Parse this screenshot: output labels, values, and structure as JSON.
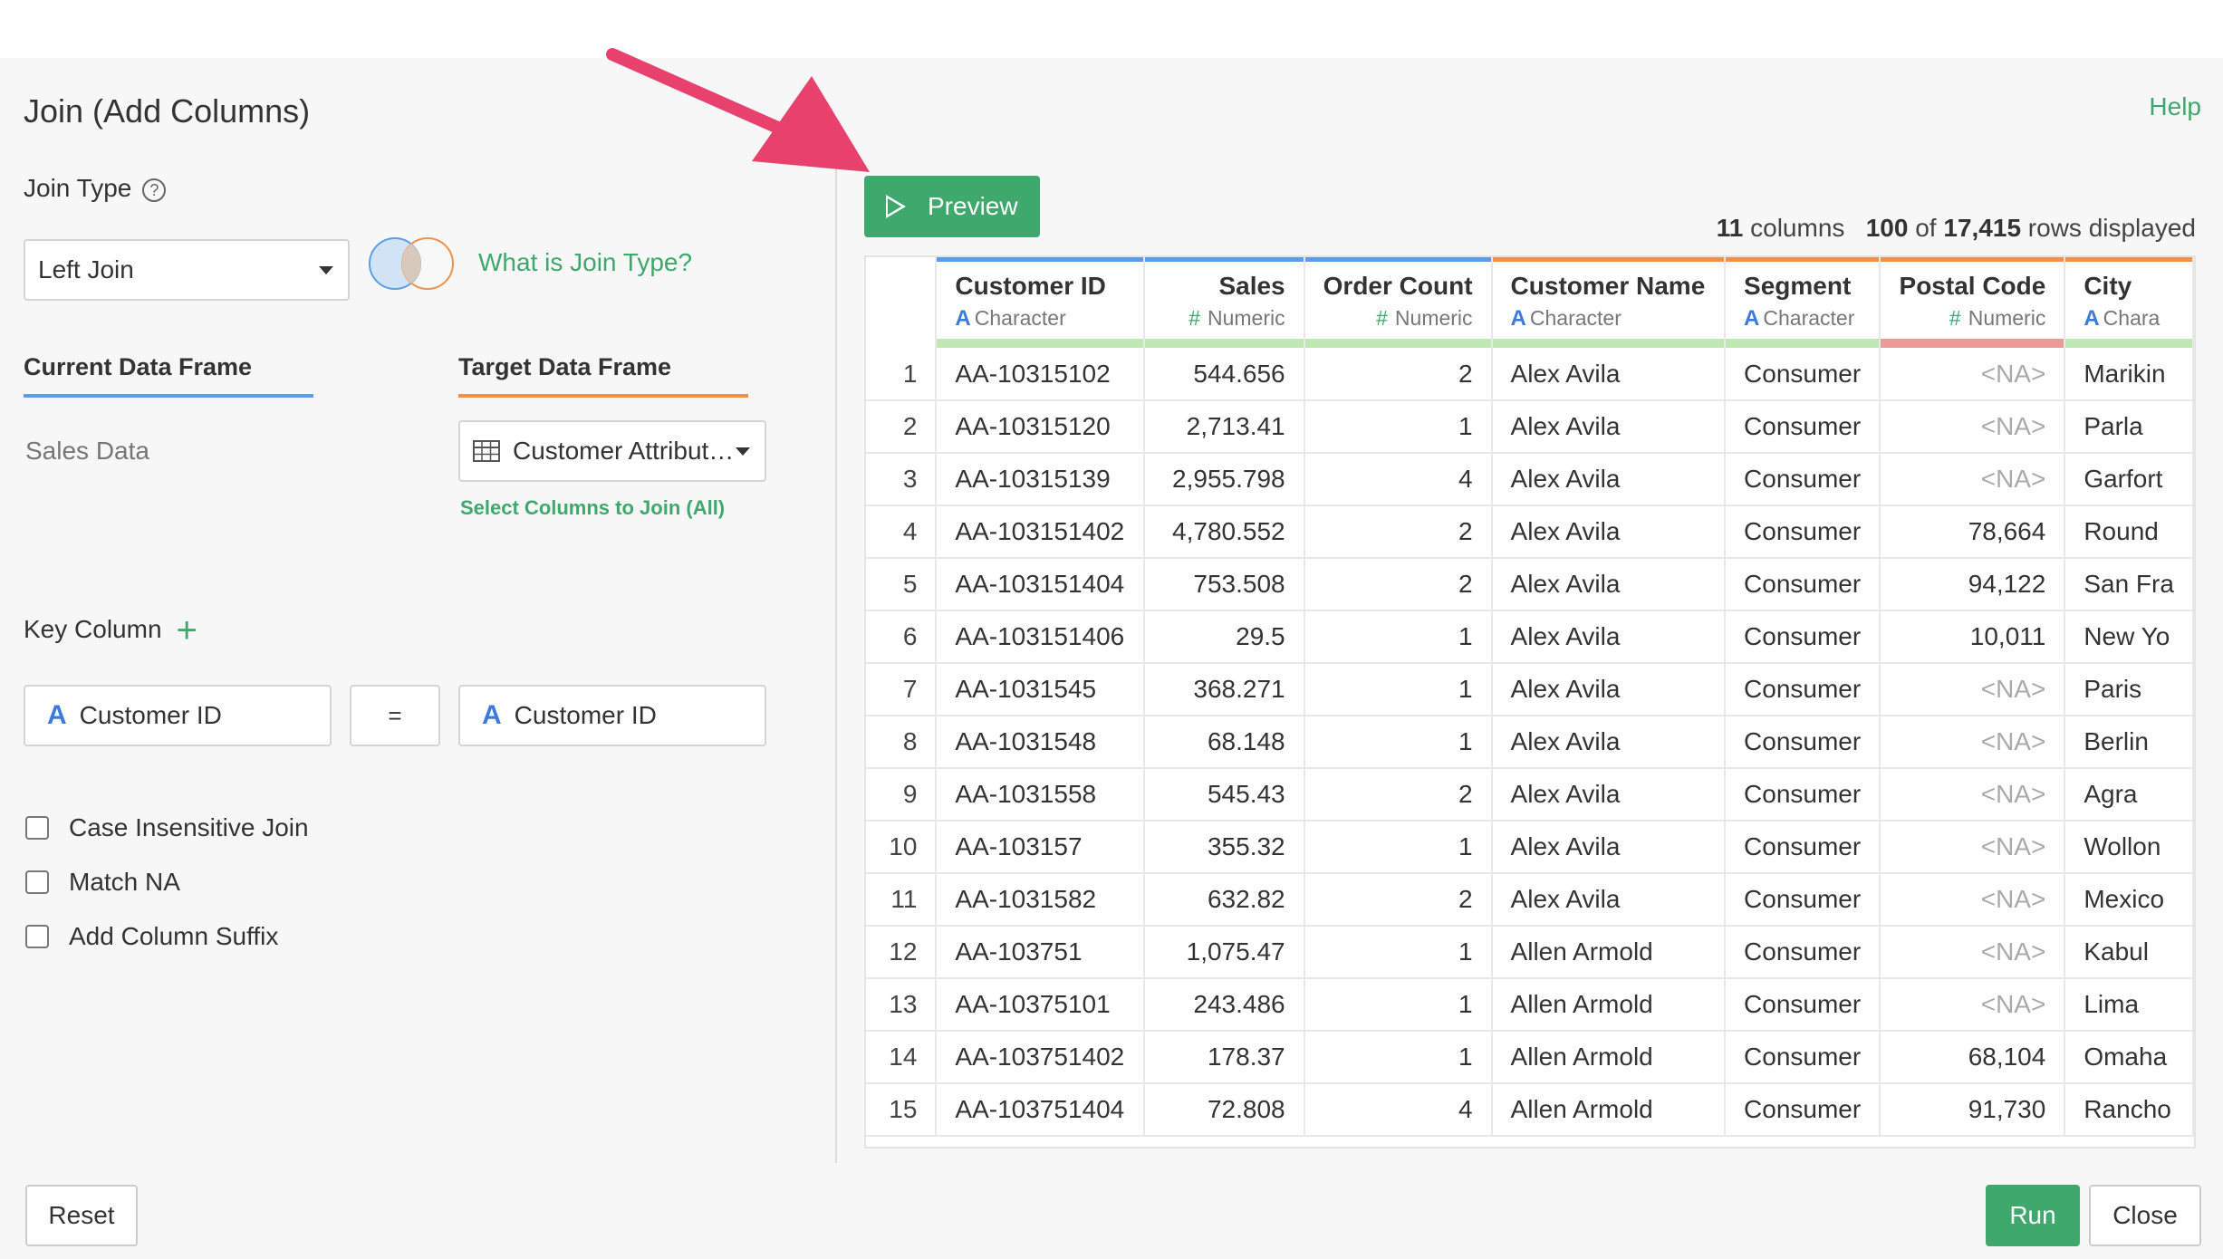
{
  "dialog": {
    "title": "Join (Add Columns)",
    "help_label": "Help"
  },
  "join_type": {
    "label": "Join Type",
    "help_symbol": "?",
    "selected": "Left Join",
    "what_is_link": "What is Join Type?"
  },
  "frames": {
    "current_label": "Current Data Frame",
    "current_value": "Sales Data",
    "target_label": "Target Data Frame",
    "target_value": "Customer Attribut…",
    "select_columns_link": "Select Columns to Join (All)"
  },
  "key_column": {
    "label": "Key Column",
    "add_symbol": "+",
    "left_type": "A",
    "left_value": "Customer ID",
    "operator": "=",
    "right_type": "A",
    "right_value": "Customer ID"
  },
  "options": [
    {
      "label": "Case Insensitive Join",
      "checked": false
    },
    {
      "label": "Match NA",
      "checked": false
    },
    {
      "label": "Add Column Suffix",
      "checked": false
    }
  ],
  "preview": {
    "button_label": "Preview",
    "columns_count": "11",
    "columns_word": "columns",
    "rows_shown": "100",
    "rows_of": "of",
    "rows_total": "17,415",
    "rows_word": "rows displayed"
  },
  "table": {
    "columns": [
      {
        "name": "Customer ID",
        "type_icon": "A",
        "type": "Character",
        "top_color": "#5b9ee8",
        "bottom_color": "#bfe8b3"
      },
      {
        "name": "Sales",
        "type_icon": "#",
        "type": "Numeric",
        "top_color": "#5b9ee8",
        "bottom_color": "#bfe8b3"
      },
      {
        "name": "Order Count",
        "type_icon": "#",
        "type": "Numeric",
        "top_color": "#5b9ee8",
        "bottom_color": "#bfe8b3"
      },
      {
        "name": "Customer Name",
        "type_icon": "A",
        "type": "Character",
        "top_color": "#ef9149",
        "bottom_color": "#bfe8b3"
      },
      {
        "name": "Segment",
        "type_icon": "A",
        "type": "Character",
        "top_color": "#ef9149",
        "bottom_color": "#bfe8b3"
      },
      {
        "name": "Postal Code",
        "type_icon": "#",
        "type": "Numeric",
        "top_color": "#ef9149",
        "bottom_color": "#ec9a98"
      },
      {
        "name": "City",
        "type_icon": "A",
        "type": "Chara",
        "top_color": "#ef9149",
        "bottom_color": "#bfe8b3"
      }
    ],
    "rows": [
      [
        "1",
        "AA-10315102",
        "544.656",
        "2",
        "Alex Avila",
        "Consumer",
        "<NA>",
        "Marikin"
      ],
      [
        "2",
        "AA-10315120",
        "2,713.41",
        "1",
        "Alex Avila",
        "Consumer",
        "<NA>",
        "Parla"
      ],
      [
        "3",
        "AA-10315139",
        "2,955.798",
        "4",
        "Alex Avila",
        "Consumer",
        "<NA>",
        "Garfort"
      ],
      [
        "4",
        "AA-103151402",
        "4,780.552",
        "2",
        "Alex Avila",
        "Consumer",
        "78,664",
        "Round"
      ],
      [
        "5",
        "AA-103151404",
        "753.508",
        "2",
        "Alex Avila",
        "Consumer",
        "94,122",
        "San Fra"
      ],
      [
        "6",
        "AA-103151406",
        "29.5",
        "1",
        "Alex Avila",
        "Consumer",
        "10,011",
        "New Yo"
      ],
      [
        "7",
        "AA-1031545",
        "368.271",
        "1",
        "Alex Avila",
        "Consumer",
        "<NA>",
        "Paris"
      ],
      [
        "8",
        "AA-1031548",
        "68.148",
        "1",
        "Alex Avila",
        "Consumer",
        "<NA>",
        "Berlin"
      ],
      [
        "9",
        "AA-1031558",
        "545.43",
        "2",
        "Alex Avila",
        "Consumer",
        "<NA>",
        "Agra"
      ],
      [
        "10",
        "AA-103157",
        "355.32",
        "1",
        "Alex Avila",
        "Consumer",
        "<NA>",
        "Wollon"
      ],
      [
        "11",
        "AA-1031582",
        "632.82",
        "2",
        "Alex Avila",
        "Consumer",
        "<NA>",
        "Mexico"
      ],
      [
        "12",
        "AA-103751",
        "1,075.47",
        "1",
        "Allen Armold",
        "Consumer",
        "<NA>",
        "Kabul"
      ],
      [
        "13",
        "AA-10375101",
        "243.486",
        "1",
        "Allen Armold",
        "Consumer",
        "<NA>",
        "Lima"
      ],
      [
        "14",
        "AA-103751402",
        "178.37",
        "1",
        "Allen Armold",
        "Consumer",
        "68,104",
        "Omaha"
      ],
      [
        "15",
        "AA-103751404",
        "72.808",
        "4",
        "Allen Armold",
        "Consumer",
        "91,730",
        "Rancho"
      ]
    ]
  },
  "footer": {
    "reset_label": "Reset",
    "run_label": "Run",
    "close_label": "Close"
  },
  "colors": {
    "accent_green": "#3fa86d",
    "type_blue": "#3e7bd9",
    "arrow_pink": "#e8416e"
  }
}
